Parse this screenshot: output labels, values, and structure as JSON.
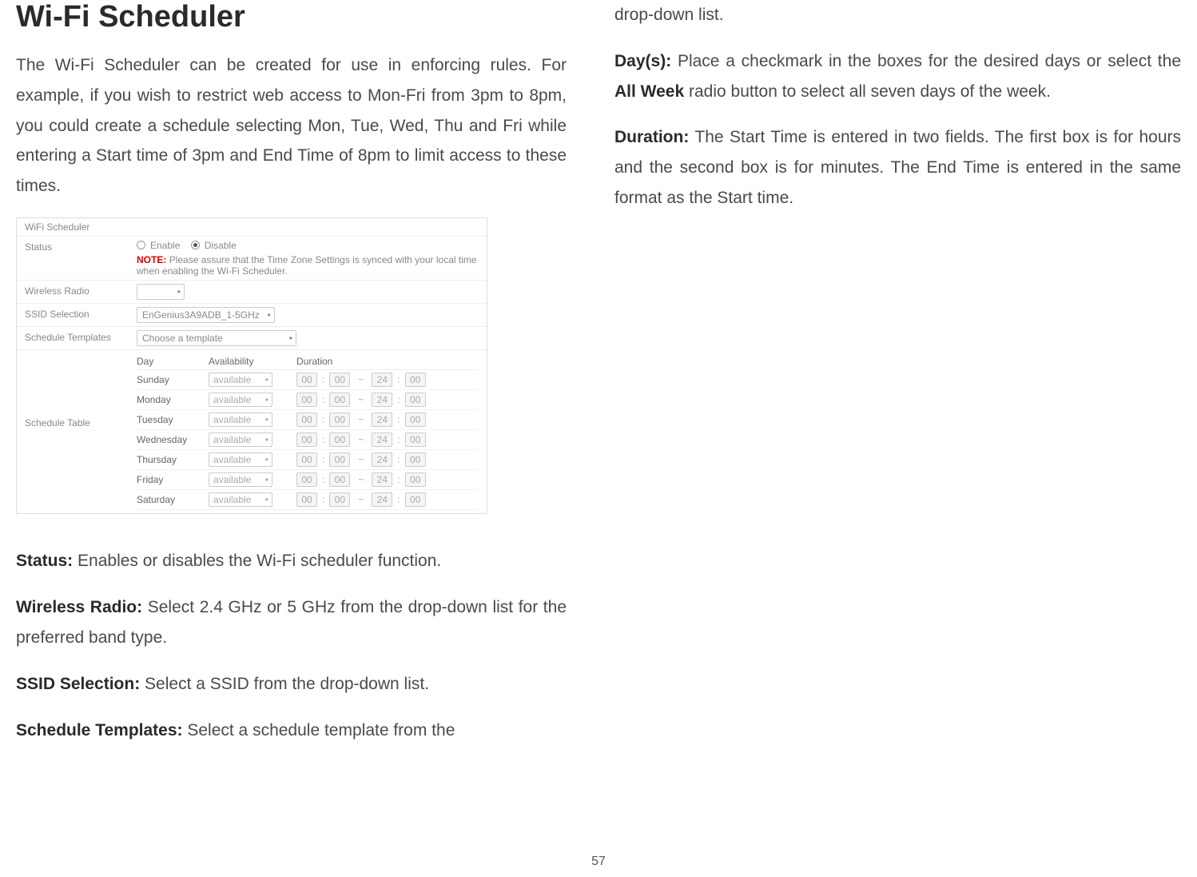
{
  "left": {
    "title": "Wi-Fi Scheduler",
    "intro": "The Wi-Fi Scheduler can be created for use in enforcing rules. For example, if you wish to restrict web access to Mon-Fri from 3pm to 8pm, you could create a schedule selecting Mon, Tue, Wed, Thu and Fri while entering a Start time of 3pm and End Time of 8pm to limit access to these times.",
    "screenshot": {
      "title": "WiFi Scheduler",
      "rows": {
        "status_label": "Status",
        "enable": "Enable",
        "disable": "Disable",
        "note_label": "NOTE:",
        "note_body": "Please assure that the Time Zone Settings is synced with your local time when enabling the Wi-Fi Scheduler.",
        "wireless_radio_label": "Wireless Radio",
        "ssid_selection_label": "SSID Selection",
        "ssid_value": "EnGenius3A9ADB_1-5GHz",
        "templates_label": "Schedule Templates",
        "templates_value": "Choose a template",
        "table_label": "Schedule Table",
        "headers": {
          "day": "Day",
          "avail": "Availability",
          "duration": "Duration"
        },
        "days": [
          {
            "name": "Sunday",
            "avail": "available",
            "sh": "00",
            "sm": "00",
            "eh": "24",
            "em": "00"
          },
          {
            "name": "Monday",
            "avail": "available",
            "sh": "00",
            "sm": "00",
            "eh": "24",
            "em": "00"
          },
          {
            "name": "Tuesday",
            "avail": "available",
            "sh": "00",
            "sm": "00",
            "eh": "24",
            "em": "00"
          },
          {
            "name": "Wednesday",
            "avail": "available",
            "sh": "00",
            "sm": "00",
            "eh": "24",
            "em": "00"
          },
          {
            "name": "Thursday",
            "avail": "available",
            "sh": "00",
            "sm": "00",
            "eh": "24",
            "em": "00"
          },
          {
            "name": "Friday",
            "avail": "available",
            "sh": "00",
            "sm": "00",
            "eh": "24",
            "em": "00"
          },
          {
            "name": "Saturday",
            "avail": "available",
            "sh": "00",
            "sm": "00",
            "eh": "24",
            "em": "00"
          }
        ]
      }
    },
    "defs": {
      "status_label": "Status:",
      "status_text": "Enables or disables the Wi-Fi scheduler function.",
      "wireless_label": "Wireless Radio:",
      "wireless_text": "Select 2.4 GHz or 5 GHz from the drop-down list for the preferred band type.",
      "ssid_label": "SSID Selection:",
      "ssid_text": "Select a SSID from the drop-down list.",
      "templates_label": "Schedule Templates:",
      "templates_text": "Select a schedule template from the"
    }
  },
  "right": {
    "continuation": "drop-down list.",
    "days_label": "Day(s):",
    "days_text_a": "Place a checkmark in the boxes for the desired days or select the ",
    "all_week": "All Week",
    "days_text_b": " radio button to select all seven days of the week.",
    "duration_label": "Duration:",
    "duration_text": "The Start Time is entered in two fields. The first box is for hours and the second box is for minutes. The End Time is entered in the same format as the Start time."
  },
  "page_number": "57"
}
